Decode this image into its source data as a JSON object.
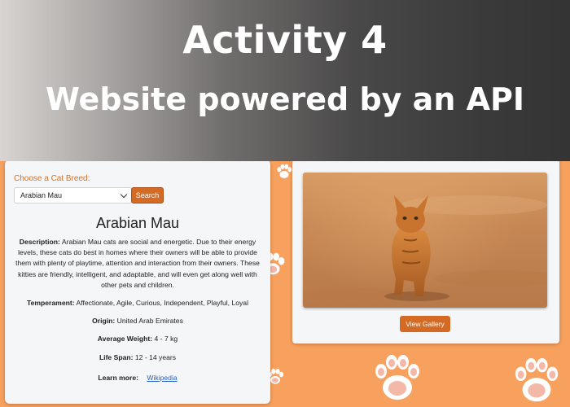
{
  "banner": {
    "title": "Activity 4",
    "subtitle": "Website powered by an API"
  },
  "breed_form": {
    "label": "Choose a Cat Breed:",
    "selected": "Arabian Mau",
    "search_label": "Search"
  },
  "breed": {
    "name": "Arabian Mau",
    "description_label": "Description:",
    "description": "Arabian Mau cats are social and energetic. Due to their energy levels, these cats do best in homes where their owners will be able to provide them with plenty of playtime, attention and interaction from their owners. These kitties are friendly, intelligent, and adaptable, and will even get along well with other pets and children.",
    "temperament_label": "Temperament:",
    "temperament": "Affectionate, Agile, Curious, Independent, Playful, Loyal",
    "origin_label": "Origin:",
    "origin": "United Arab Emirates",
    "weight_label": "Average Weight:",
    "weight": "4 - 7 kg",
    "lifespan_label": "Life Span:",
    "lifespan": "12 - 14 years",
    "learn_more_label": "Learn more:",
    "learn_more_link": "Wikipedia"
  },
  "gallery": {
    "button_label": "View Gallery"
  },
  "colors": {
    "background": "#f8a05e",
    "accent": "#d46b25",
    "link": "#2563c9"
  }
}
